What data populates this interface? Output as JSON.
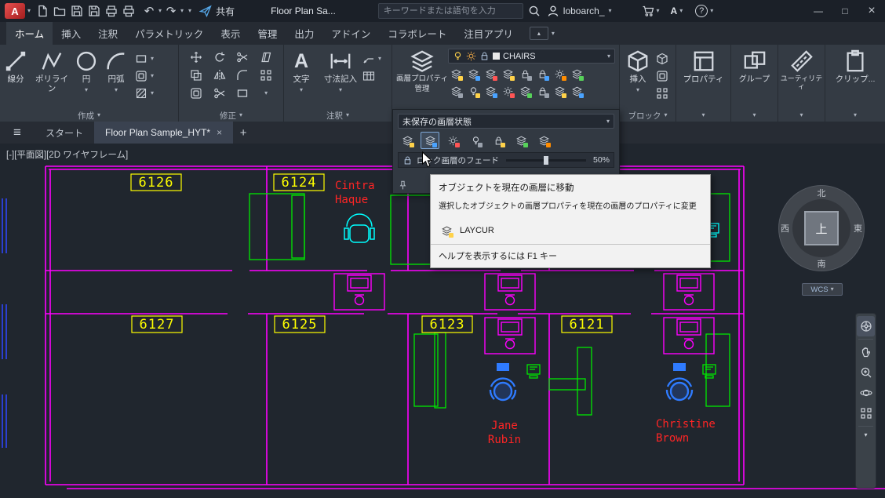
{
  "icons": {
    "caret_down": "▾",
    "caret_up": "▴",
    "hamburger": "≡",
    "minimize": "—",
    "maximize": "□",
    "close": "×",
    "tab_close": "×",
    "plus": "+",
    "help": "?",
    "undo": "↶",
    "redo": "↷",
    "text_tool": "A"
  },
  "titlebar": {
    "logo_letter": "A",
    "share_label": "共有",
    "doc_title": "Floor Plan Sa...",
    "search_placeholder": "キーワードまたは語句を入力",
    "user": "loboarch_",
    "signin_letter": "A"
  },
  "tabs": {
    "items": [
      {
        "label": "ホーム"
      },
      {
        "label": "挿入"
      },
      {
        "label": "注釈"
      },
      {
        "label": "パラメトリック"
      },
      {
        "label": "表示"
      },
      {
        "label": "管理"
      },
      {
        "label": "出力"
      },
      {
        "label": "アドイン"
      },
      {
        "label": "コラボレート"
      },
      {
        "label": "注目アプリ"
      }
    ]
  },
  "panels": {
    "draw": {
      "label": "作成",
      "line": "線分",
      "pline": "ポリライン",
      "circle": "円",
      "arc": "円弧"
    },
    "modify": {
      "label": "修正"
    },
    "annotate": {
      "label": "注釈",
      "text": "文字",
      "dim": "寸法記入"
    },
    "layers": {
      "manager_l1": "画層プロパティ",
      "manager_l2": "管理",
      "current": "CHAIRS"
    },
    "block": {
      "label": "ブロック",
      "insert": "挿入"
    },
    "props": {
      "label": "プロパティ"
    },
    "groups": {
      "label": "グループ"
    },
    "utils": {
      "label": "ユーティリティ"
    },
    "clip": {
      "label": "クリップ..."
    }
  },
  "flyout": {
    "state": "未保存の画層状態",
    "fade_label": "ロック画層のフェード",
    "fade_value": "50%"
  },
  "tooltip": {
    "title": "オブジェクトを現在の画層に移動",
    "desc": "選択したオブジェクトの画層プロパティを現在の画層のプロパティに変更",
    "command": "LAYCUR",
    "help": "ヘルプを表示するには F1 キー"
  },
  "filetabs": {
    "start": "スタート",
    "drawing": "Floor Plan Sample_HYT*"
  },
  "viewport_label": "[-][平面図][2D ワイヤフレーム]",
  "viewcube": {
    "n": "北",
    "e": "東",
    "w": "西",
    "s": "南",
    "top": "上",
    "wcs": "WCS"
  },
  "plan": {
    "rooms": [
      {
        "num": "6126"
      },
      {
        "num": "6124"
      },
      {
        "num": "6127"
      },
      {
        "num": "6125"
      },
      {
        "num": "6123"
      },
      {
        "num": "6121"
      }
    ],
    "occupants": [
      {
        "l1": "Cintra",
        "l2": "Haque"
      },
      {
        "l1": "Jane",
        "l2": "Rubin"
      },
      {
        "l1": "Christine",
        "l2": "Brown"
      }
    ]
  }
}
